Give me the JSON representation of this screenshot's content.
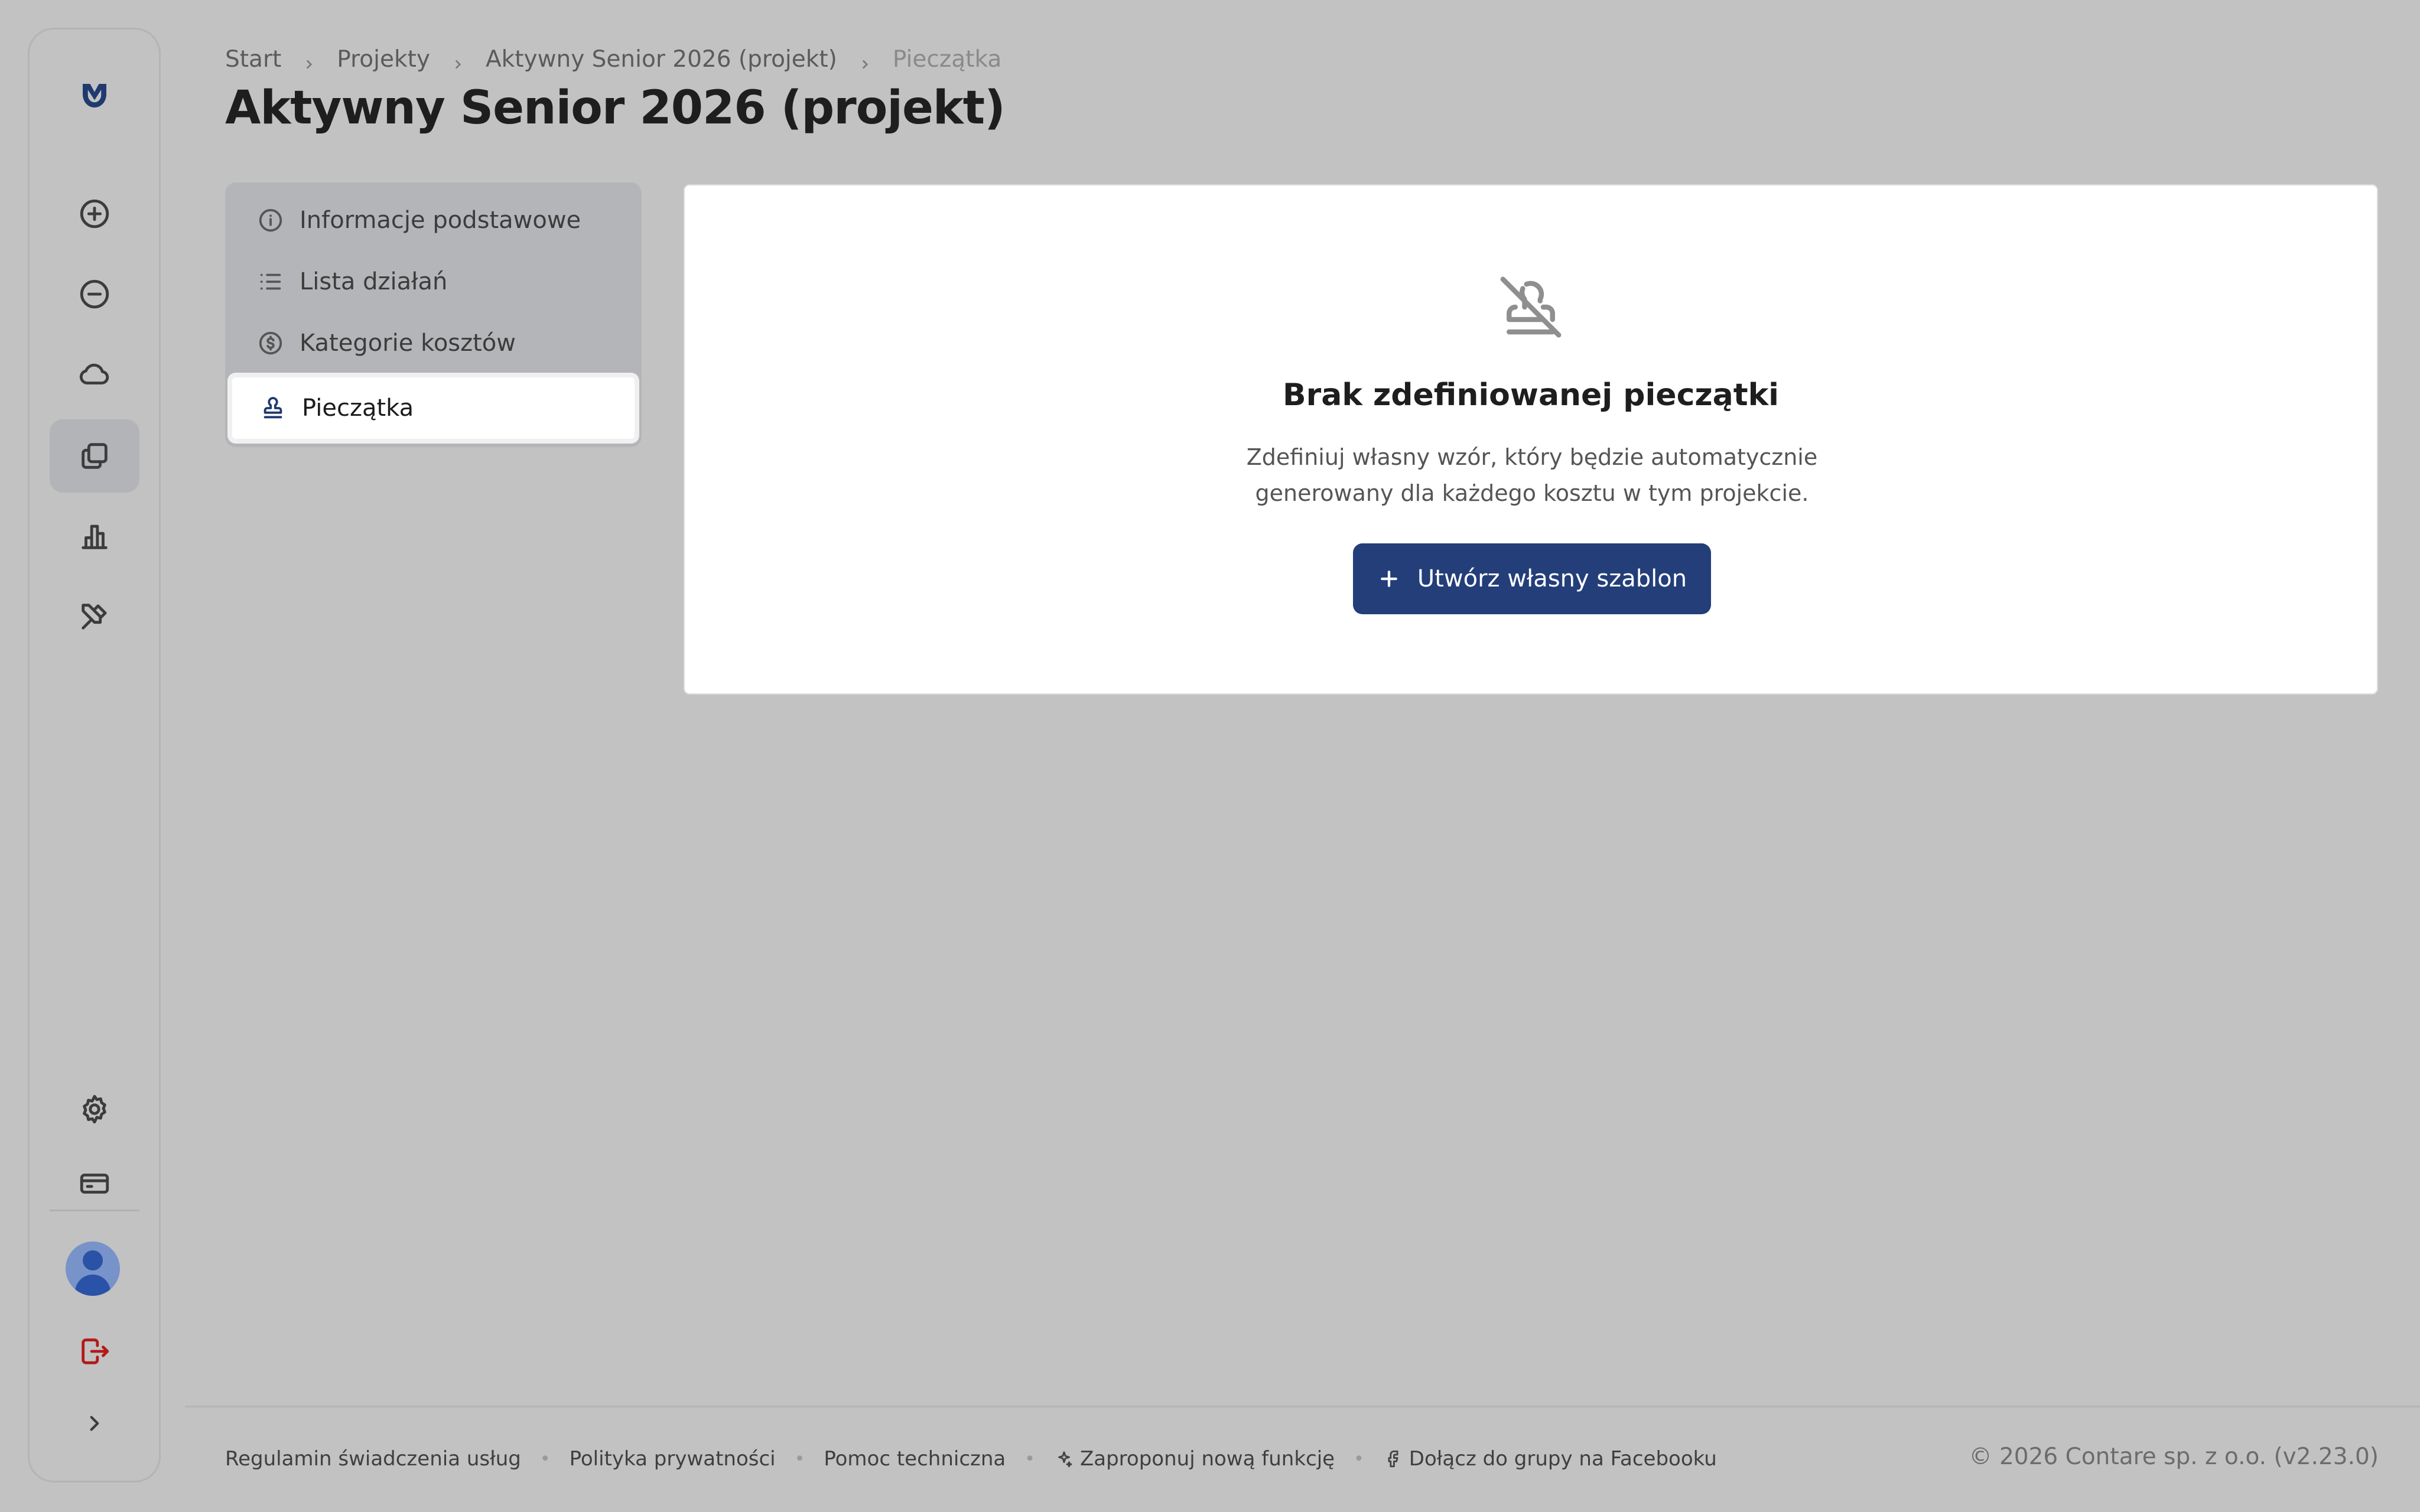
{
  "sidebar": {
    "items": [
      {
        "icon": "logo-icon"
      },
      {
        "icon": "plus-circle-icon"
      },
      {
        "icon": "minus-circle-icon"
      },
      {
        "icon": "cloud-icon"
      },
      {
        "icon": "documents-icon",
        "active": true
      },
      {
        "icon": "bar-chart-icon"
      },
      {
        "icon": "tools-icon"
      }
    ],
    "bottom": [
      {
        "icon": "gear-icon"
      },
      {
        "icon": "credit-card-icon"
      },
      {
        "icon": "avatar"
      },
      {
        "icon": "logout-icon",
        "color": "#b31a1a"
      },
      {
        "icon": "chevron-right-icon"
      }
    ]
  },
  "breadcrumb": {
    "items": [
      "Start",
      "Projekty",
      "Aktywny Senior 2026 (projekt)"
    ],
    "current": "Pieczątka"
  },
  "page": {
    "title": "Aktywny Senior 2026 (projekt)"
  },
  "section_nav": {
    "items": [
      {
        "label": "Informacje podstawowe",
        "icon": "info-icon"
      },
      {
        "label": "Lista działań",
        "icon": "list-icon"
      },
      {
        "label": "Kategorie kosztów",
        "icon": "dollar-circle-icon"
      },
      {
        "label": "Pieczątka",
        "icon": "stamp-icon",
        "active": true
      }
    ]
  },
  "empty_state": {
    "icon": "stamp-off-icon",
    "title": "Brak zdefiniowanej pieczątki",
    "description_line1": "Zdefiniuj własny wzór, który będzie automatycznie",
    "description_line2": "generowany dla każdego kosztu w tym projekcie.",
    "button_label": "Utwórz własny szablon"
  },
  "footer": {
    "links": [
      "Regulamin świadczenia usług",
      "Polityka prywatności",
      "Pomoc techniczna",
      "Zaproponuj nową funkcję",
      "Dołącz do grupy na Facebooku"
    ],
    "copyright": "© 2026 Contare sp. z o.o. (v2.23.0)"
  },
  "colors": {
    "accent": "#233e79",
    "background": "#c2c2c2",
    "card": "#ffffff"
  }
}
